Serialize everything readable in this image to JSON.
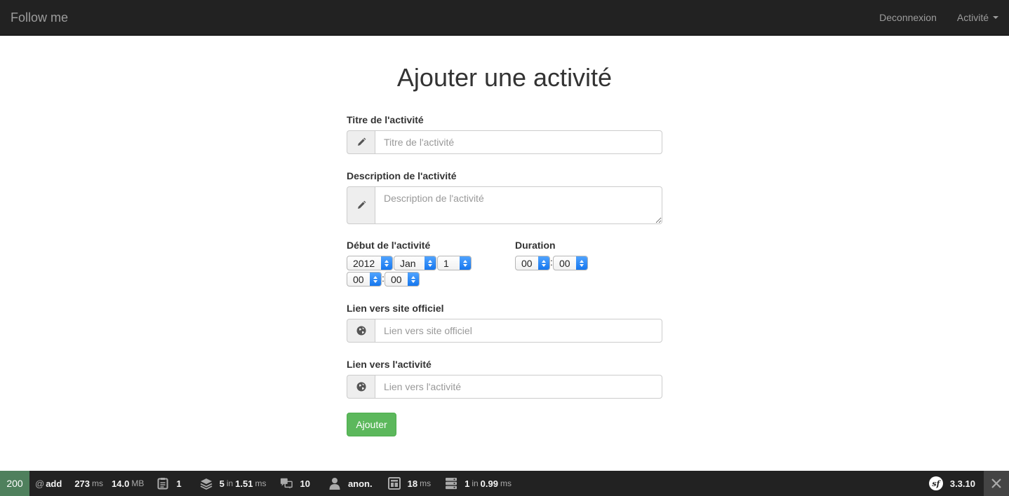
{
  "navbar": {
    "brand": "Follow me",
    "logout": "Deconnexion",
    "activity_menu": "Activité"
  },
  "page": {
    "title": "Ajouter une activité"
  },
  "form": {
    "title_label": "Titre de l'activité",
    "title_placeholder": "Titre de l'activité",
    "description_label": "Description de l'activité",
    "description_placeholder": "Description de l'activité",
    "start_label": "Début de l'activité",
    "start_year": "2012",
    "start_month": "Jan",
    "start_day": "1",
    "start_hour": "00",
    "start_minute": "00",
    "duration_label": "Duration",
    "duration_hour": "00",
    "duration_minute": "00",
    "time_separator": ":",
    "official_site_label": "Lien vers site officiel",
    "official_site_placeholder": "Lien vers site officiel",
    "activity_link_label": "Lien vers l'activité",
    "activity_link_placeholder": "Lien vers l'activité",
    "submit": "Ajouter"
  },
  "toolbar": {
    "status": "200",
    "route": "add",
    "time_value": "273",
    "time_unit": "ms",
    "memory_value": "14.0",
    "memory_unit": "MB",
    "logs": "1",
    "events_count": "5",
    "events_in": "in",
    "events_time": "1.51",
    "events_unit": "ms",
    "translations": "10",
    "user": "anon.",
    "twig_time": "18",
    "twig_unit": "ms",
    "cache_count": "1",
    "cache_in": "in",
    "cache_time": "0.99",
    "cache_unit": "ms",
    "version": "3.3.10",
    "colors": {
      "status_ok": "#4f805d",
      "background": "#222222"
    }
  }
}
